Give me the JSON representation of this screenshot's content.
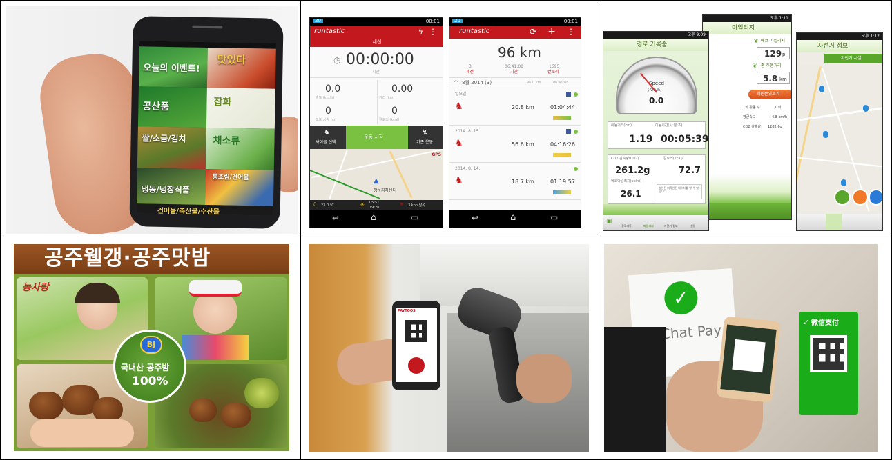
{
  "panel1": {
    "tiles": [
      "오늘의 이벤트!",
      "맛있다",
      "공산품",
      "잡화",
      "쌀/소금/김치",
      "채소류",
      "냉동/냉장식품",
      "통조림/건어물"
    ],
    "bottom_text": "건어물/축산물/수산물"
  },
  "panel2": {
    "left_screen": {
      "brand": "runtastic",
      "section_label": "세션",
      "timer": "00:00:00",
      "timer_sub": "시간",
      "stats": [
        {
          "value": "0.0",
          "label": "속도 (km/h)"
        },
        {
          "value": "0.00",
          "label": "거리 (km)"
        },
        {
          "value": "0",
          "label": "고도 상승 (m)"
        },
        {
          "value": "0",
          "label": "칼로리 (kcal)"
        }
      ],
      "buttons": [
        "사이클 선택",
        "운동 시작",
        "기존 운동"
      ],
      "map_labels": [
        "GPS",
        "행운지하센터"
      ],
      "weather": [
        "23.0 °C",
        "05:51",
        "19:20",
        "3 kph 남쪽"
      ],
      "status_time": "00:01"
    },
    "right_screen": {
      "brand": "runtastic",
      "total": "96 km",
      "summary": [
        {
          "value": "3",
          "label": "세션"
        },
        {
          "value": "06:41:08",
          "label": "기간"
        },
        {
          "value": "1695",
          "label": "칼로리"
        }
      ],
      "month": "8월 2014 (3)",
      "month_distance": "96.0 km",
      "month_time": "06:41:08",
      "entries": [
        {
          "date": "일요일",
          "distance": "20.8 km",
          "time": "01:04:44"
        },
        {
          "date": "2014. 8. 15.",
          "distance": "56.6 km",
          "time": "04:16:26"
        },
        {
          "date": "2014. 8. 14.",
          "distance": "18.7 km",
          "time": "01:19:57"
        }
      ],
      "status_time": "00:01"
    }
  },
  "panel3": {
    "left_screen": {
      "status_time": "오후 9:09",
      "title": "경로 기록중",
      "speed_label": "Speed",
      "speed_unit": "(Km/h)",
      "speed_value": "0.0",
      "distance_label": "이동거리(km)",
      "time_label": "이동시간(시:분:초)",
      "distance": "1.19",
      "time": "00:05:39",
      "co2_label": "CO2 감축량(CO2)",
      "co2": "261.2g",
      "cal_label": "칼로리(kcal)",
      "cal": "72.7",
      "eco_label": "에코마일리지(point)",
      "eco": "26.1",
      "note": "승인전 미확인된 데이터를 알 수 있습니다",
      "tabs": [
        "경로기록",
        "마일리지",
        "자전거 정보",
        "설정"
      ]
    },
    "mid_screen": {
      "status_time": "오후 1:11",
      "title": "마일리지",
      "eco_label": "에코 마일리지",
      "eco": "129",
      "eco_unit": "p",
      "total_label": "총 주행거리",
      "total": "5.8",
      "total_unit": "km",
      "rank_button": "회원순위보기",
      "rows": [
        {
          "label": "1회 활동 수",
          "value": "1 회"
        },
        {
          "label": "평균속도",
          "value": "4.8 km/h"
        },
        {
          "label": "CO2 감축량",
          "value": "1282.6g"
        }
      ]
    },
    "right_screen": {
      "status_time": "오후 1:12",
      "title": "자전거 정보",
      "tab": "자전거 시설"
    }
  },
  "panel4": {
    "title": "공주웰갱·공주맛밤",
    "logo": "농사랑",
    "badge": "BJ",
    "seal_line1": "국내산 공주밤",
    "seal_line2": "100%"
  },
  "panel5": {
    "app_name": "PAYTOOS"
  },
  "panel6": {
    "sign": "WeChat Pay",
    "stand": "微信支付"
  },
  "colors": {
    "runtastic_red": "#c3181e",
    "runtastic_green": "#7ac142",
    "eco_green": "#5aa52b",
    "wechat_green": "#1aad19",
    "banner_brown": "#8a4a1e"
  }
}
